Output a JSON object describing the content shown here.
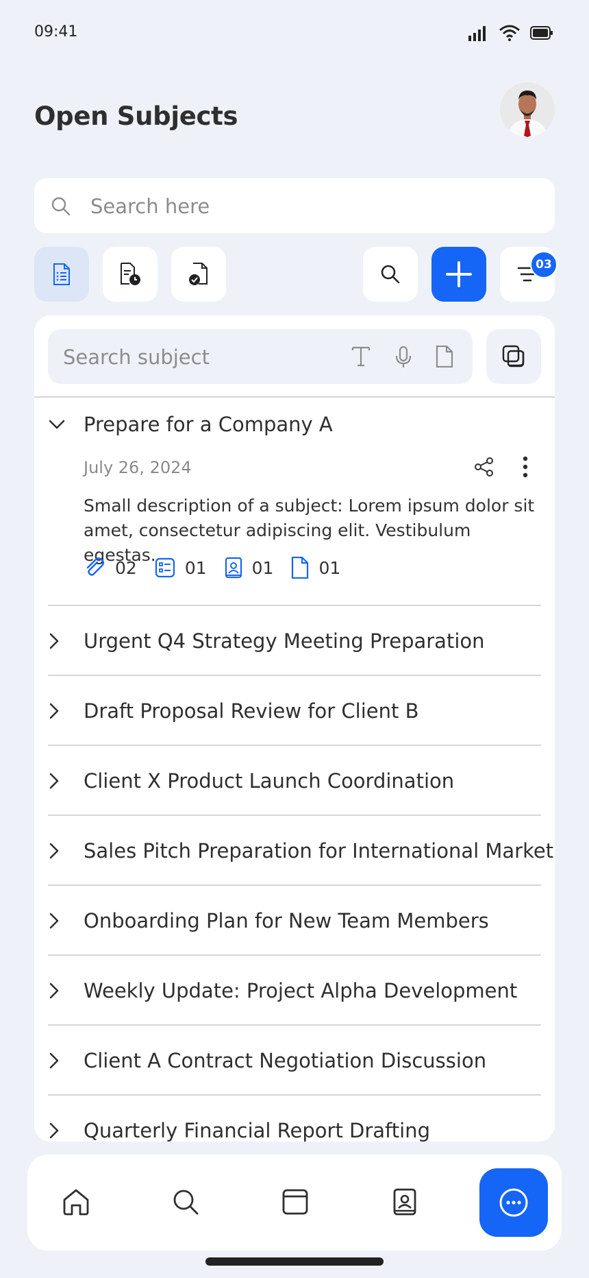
{
  "status_bar": {
    "time": "09:41"
  },
  "header": {
    "title": "Open Subjects"
  },
  "search": {
    "placeholder": "Search here"
  },
  "toolbar": {
    "filter_badge": "03"
  },
  "subject_search": {
    "placeholder": "Search subject"
  },
  "expanded_subject": {
    "title": "Prepare for a Company A",
    "date": "July 26, 2024",
    "description": "Small description of a subject: Lorem ipsum dolor sit amet, consectetur adipiscing elit. Vestibulum egestas.",
    "meta": {
      "attachments": "02",
      "lists": "01",
      "contacts": "01",
      "documents": "01"
    }
  },
  "subjects": [
    {
      "title": "Urgent Q4 Strategy Meeting Preparation"
    },
    {
      "title": "Draft Proposal Review for Client B"
    },
    {
      "title": "Client X Product Launch Coordination"
    },
    {
      "title": "Sales Pitch Preparation for International Market"
    },
    {
      "title": "Onboarding Plan for New Team Members"
    },
    {
      "title": "Weekly Update: Project Alpha Development"
    },
    {
      "title": "Client A Contract Negotiation Discussion"
    },
    {
      "title": "Quarterly Financial Report Drafting"
    }
  ],
  "colors": {
    "accent": "#1565F6",
    "background": "#EEF2F8",
    "active_tab": "#DCE6F7"
  }
}
